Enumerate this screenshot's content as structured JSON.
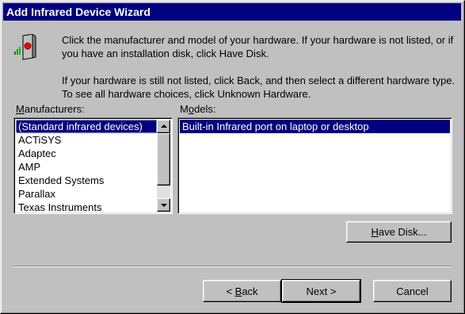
{
  "window": {
    "title": "Add Infrared Device Wizard"
  },
  "instructions": {
    "para1": "Click the manufacturer and model of your hardware. If your hardware is not listed, or if you have an installation disk, click Have Disk.",
    "para2": "If your hardware is still not listed, click Back, and then select a different hardware type. To see all hardware choices, click Unknown Hardware."
  },
  "manufacturers": {
    "label_prefix": "",
    "label_access": "M",
    "label_rest": "anufacturers:",
    "items": [
      "(Standard infrared devices)",
      "ACTiSYS",
      "Adaptec",
      "AMP",
      "Extended Systems",
      "Parallax",
      "Texas Instruments"
    ],
    "selected": "(Standard infrared devices)"
  },
  "models": {
    "label_prefix": "M",
    "label_access": "o",
    "label_rest": "dels:",
    "items": [
      "Built-in Infrared port on laptop or desktop"
    ],
    "selected": "Built-in Infrared port on laptop or desktop"
  },
  "buttons": {
    "have_disk": {
      "prefix": "",
      "access": "H",
      "rest": "ave Disk..."
    },
    "back": {
      "prefix": "< ",
      "access": "B",
      "rest": "ack"
    },
    "next": "Next >",
    "cancel": "Cancel"
  },
  "icons": {
    "wizard": "infrared-device-icon"
  },
  "colors": {
    "titlebar": "#000080",
    "face": "#c0c0c0",
    "selection": "#000080"
  }
}
